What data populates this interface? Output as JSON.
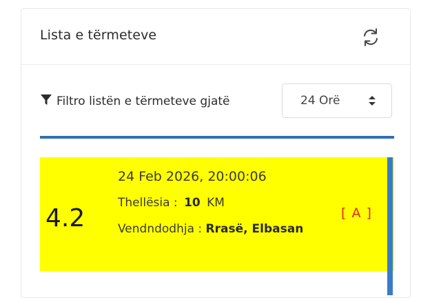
{
  "panel": {
    "title": "Lista e tërmeteve",
    "refresh_icon": "refresh-icon"
  },
  "filter": {
    "icon": "filter-icon",
    "label": "Filtro listën e tërmeteve gjatë",
    "selected": "24 Orë"
  },
  "colors": {
    "highlight": "#ffff00",
    "accent": "#2f6fb3",
    "badge": "#e0261b"
  },
  "earthquakes": [
    {
      "magnitude": "4.2",
      "datetime": "24 Feb 2026, 20:00:06",
      "depth_label": "Thellësia :",
      "depth_value": "10",
      "depth_unit": "KM",
      "location_label": "Vendndodhja :",
      "location_value": "Rrasë, Elbasan",
      "badge": "[ A ]"
    }
  ]
}
